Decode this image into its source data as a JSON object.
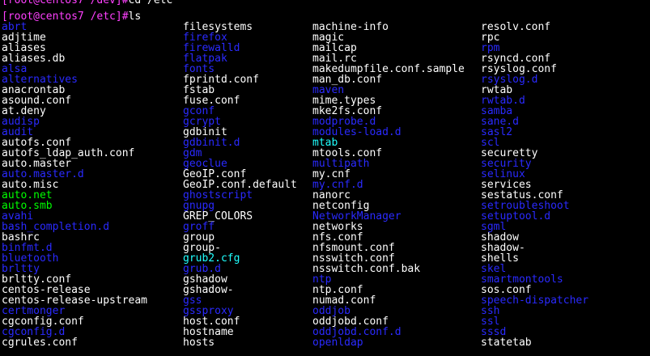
{
  "terminal": {
    "prompt_lines": [
      {
        "prompt": "[root@centos7 /dev]#",
        "command": "cd /etc"
      },
      {
        "prompt": "[root@centos7 /etc]#",
        "command": "ls"
      }
    ],
    "colors": {
      "background": "#000000",
      "prompt": "#ff40ff",
      "file": "#ffffff",
      "dir": "#2a2aff",
      "exec": "#00ff00",
      "link": "#20ffff"
    },
    "columns": [
      [
        {
          "name": "abrt",
          "kind": "dir"
        },
        {
          "name": "adjtime",
          "kind": "file"
        },
        {
          "name": "aliases",
          "kind": "file"
        },
        {
          "name": "aliases.db",
          "kind": "file"
        },
        {
          "name": "alsa",
          "kind": "dir"
        },
        {
          "name": "alternatives",
          "kind": "dir"
        },
        {
          "name": "anacrontab",
          "kind": "file"
        },
        {
          "name": "asound.conf",
          "kind": "file"
        },
        {
          "name": "at.deny",
          "kind": "file"
        },
        {
          "name": "audisp",
          "kind": "dir"
        },
        {
          "name": "audit",
          "kind": "dir"
        },
        {
          "name": "autofs.conf",
          "kind": "file"
        },
        {
          "name": "autofs_ldap_auth.conf",
          "kind": "file"
        },
        {
          "name": "auto.master",
          "kind": "file"
        },
        {
          "name": "auto.master.d",
          "kind": "dir"
        },
        {
          "name": "auto.misc",
          "kind": "file"
        },
        {
          "name": "auto.net",
          "kind": "exec"
        },
        {
          "name": "auto.smb",
          "kind": "exec"
        },
        {
          "name": "avahi",
          "kind": "dir"
        },
        {
          "name": "bash_completion.d",
          "kind": "dir"
        },
        {
          "name": "bashrc",
          "kind": "file"
        },
        {
          "name": "binfmt.d",
          "kind": "dir"
        },
        {
          "name": "bluetooth",
          "kind": "dir"
        },
        {
          "name": "brltty",
          "kind": "dir"
        },
        {
          "name": "brltty.conf",
          "kind": "file"
        },
        {
          "name": "centos-release",
          "kind": "file"
        },
        {
          "name": "centos-release-upstream",
          "kind": "file"
        },
        {
          "name": "certmonger",
          "kind": "dir"
        },
        {
          "name": "cgconfig.conf",
          "kind": "file"
        },
        {
          "name": "cgconfig.d",
          "kind": "dir"
        },
        {
          "name": "cgrules.conf",
          "kind": "file"
        }
      ],
      [
        {
          "name": "filesystems",
          "kind": "file"
        },
        {
          "name": "firefox",
          "kind": "dir"
        },
        {
          "name": "firewalld",
          "kind": "dir"
        },
        {
          "name": "flatpak",
          "kind": "dir"
        },
        {
          "name": "fonts",
          "kind": "dir"
        },
        {
          "name": "fprintd.conf",
          "kind": "file"
        },
        {
          "name": "fstab",
          "kind": "file"
        },
        {
          "name": "fuse.conf",
          "kind": "file"
        },
        {
          "name": "gconf",
          "kind": "dir"
        },
        {
          "name": "gcrypt",
          "kind": "dir"
        },
        {
          "name": "gdbinit",
          "kind": "file"
        },
        {
          "name": "gdbinit.d",
          "kind": "dir"
        },
        {
          "name": "gdm",
          "kind": "dir"
        },
        {
          "name": "geoclue",
          "kind": "dir"
        },
        {
          "name": "GeoIP.conf",
          "kind": "file"
        },
        {
          "name": "GeoIP.conf.default",
          "kind": "file"
        },
        {
          "name": "ghostscript",
          "kind": "dir"
        },
        {
          "name": "gnupg",
          "kind": "dir"
        },
        {
          "name": "GREP_COLORS",
          "kind": "file"
        },
        {
          "name": "groff",
          "kind": "dir"
        },
        {
          "name": "group",
          "kind": "file"
        },
        {
          "name": "group-",
          "kind": "file"
        },
        {
          "name": "grub2.cfg",
          "kind": "link"
        },
        {
          "name": "grub.d",
          "kind": "dir"
        },
        {
          "name": "gshadow",
          "kind": "file"
        },
        {
          "name": "gshadow-",
          "kind": "file"
        },
        {
          "name": "gss",
          "kind": "dir"
        },
        {
          "name": "gssproxy",
          "kind": "dir"
        },
        {
          "name": "host.conf",
          "kind": "file"
        },
        {
          "name": "hostname",
          "kind": "file"
        },
        {
          "name": "hosts",
          "kind": "file"
        }
      ],
      [
        {
          "name": "machine-info",
          "kind": "file"
        },
        {
          "name": "magic",
          "kind": "file"
        },
        {
          "name": "mailcap",
          "kind": "file"
        },
        {
          "name": "mail.rc",
          "kind": "file"
        },
        {
          "name": "makedumpfile.conf.sample",
          "kind": "file"
        },
        {
          "name": "man_db.conf",
          "kind": "file"
        },
        {
          "name": "maven",
          "kind": "dir"
        },
        {
          "name": "mime.types",
          "kind": "file"
        },
        {
          "name": "mke2fs.conf",
          "kind": "file"
        },
        {
          "name": "modprobe.d",
          "kind": "dir"
        },
        {
          "name": "modules-load.d",
          "kind": "dir"
        },
        {
          "name": "mtab",
          "kind": "link"
        },
        {
          "name": "mtools.conf",
          "kind": "file"
        },
        {
          "name": "multipath",
          "kind": "dir"
        },
        {
          "name": "my.cnf",
          "kind": "file"
        },
        {
          "name": "my.cnf.d",
          "kind": "dir"
        },
        {
          "name": "nanorc",
          "kind": "file"
        },
        {
          "name": "netconfig",
          "kind": "file"
        },
        {
          "name": "NetworkManager",
          "kind": "dir"
        },
        {
          "name": "networks",
          "kind": "file"
        },
        {
          "name": "nfs.conf",
          "kind": "file"
        },
        {
          "name": "nfsmount.conf",
          "kind": "file"
        },
        {
          "name": "nsswitch.conf",
          "kind": "file"
        },
        {
          "name": "nsswitch.conf.bak",
          "kind": "file"
        },
        {
          "name": "ntp",
          "kind": "dir"
        },
        {
          "name": "ntp.conf",
          "kind": "file"
        },
        {
          "name": "numad.conf",
          "kind": "file"
        },
        {
          "name": "oddjob",
          "kind": "dir"
        },
        {
          "name": "oddjobd.conf",
          "kind": "file"
        },
        {
          "name": "oddjobd.conf.d",
          "kind": "dir"
        },
        {
          "name": "openldap",
          "kind": "dir"
        }
      ],
      [
        {
          "name": "resolv.conf",
          "kind": "file"
        },
        {
          "name": "rpc",
          "kind": "file"
        },
        {
          "name": "rpm",
          "kind": "dir"
        },
        {
          "name": "rsyncd.conf",
          "kind": "file"
        },
        {
          "name": "rsyslog.conf",
          "kind": "file"
        },
        {
          "name": "rsyslog.d",
          "kind": "dir"
        },
        {
          "name": "rwtab",
          "kind": "file"
        },
        {
          "name": "rwtab.d",
          "kind": "dir"
        },
        {
          "name": "samba",
          "kind": "dir"
        },
        {
          "name": "sane.d",
          "kind": "dir"
        },
        {
          "name": "sasl2",
          "kind": "dir"
        },
        {
          "name": "scl",
          "kind": "dir"
        },
        {
          "name": "securetty",
          "kind": "file"
        },
        {
          "name": "security",
          "kind": "dir"
        },
        {
          "name": "selinux",
          "kind": "dir"
        },
        {
          "name": "services",
          "kind": "file"
        },
        {
          "name": "sestatus.conf",
          "kind": "file"
        },
        {
          "name": "setroubleshoot",
          "kind": "dir"
        },
        {
          "name": "setuptool.d",
          "kind": "dir"
        },
        {
          "name": "sgml",
          "kind": "dir"
        },
        {
          "name": "shadow",
          "kind": "file"
        },
        {
          "name": "shadow-",
          "kind": "file"
        },
        {
          "name": "shells",
          "kind": "file"
        },
        {
          "name": "skel",
          "kind": "dir"
        },
        {
          "name": "smartmontools",
          "kind": "dir"
        },
        {
          "name": "sos.conf",
          "kind": "file"
        },
        {
          "name": "speech-dispatcher",
          "kind": "dir"
        },
        {
          "name": "ssh",
          "kind": "dir"
        },
        {
          "name": "ssl",
          "kind": "dir"
        },
        {
          "name": "sssd",
          "kind": "dir"
        },
        {
          "name": "statetab",
          "kind": "file"
        }
      ]
    ]
  }
}
